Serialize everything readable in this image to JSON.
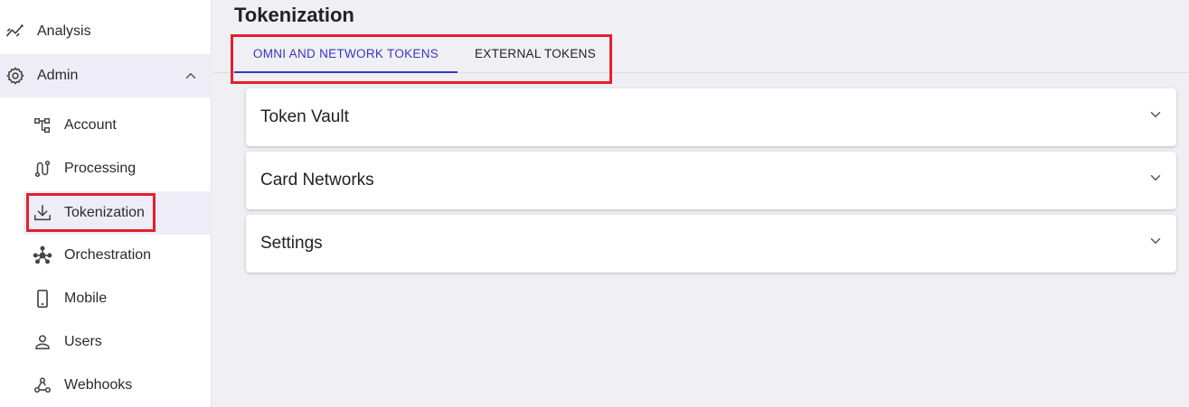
{
  "sidebar": {
    "items": [
      {
        "label": "Analysis",
        "icon": "analytics-icon"
      },
      {
        "label": "Admin",
        "icon": "gear-icon",
        "expanded": true
      },
      {
        "label": "Account",
        "icon": "org-chart-icon"
      },
      {
        "label": "Processing",
        "icon": "route-icon"
      },
      {
        "label": "Tokenization",
        "icon": "download-tray-icon",
        "selected": true
      },
      {
        "label": "Orchestration",
        "icon": "hub-icon"
      },
      {
        "label": "Mobile",
        "icon": "mobile-phone-icon"
      },
      {
        "label": "Users",
        "icon": "user-icon"
      },
      {
        "label": "Webhooks",
        "icon": "webhook-icon"
      }
    ]
  },
  "main": {
    "title": "Tokenization",
    "tabs": [
      {
        "label": "OMNI AND NETWORK TOKENS",
        "active": true
      },
      {
        "label": "EXTERNAL TOKENS",
        "active": false
      }
    ],
    "sections": [
      {
        "title": "Token Vault"
      },
      {
        "title": "Card Networks"
      },
      {
        "title": "Settings"
      }
    ]
  },
  "colors": {
    "accent": "#3b36c4",
    "highlight": "#e3202e",
    "background": "#f0eff3",
    "selected_bg": "#eeecf7"
  }
}
